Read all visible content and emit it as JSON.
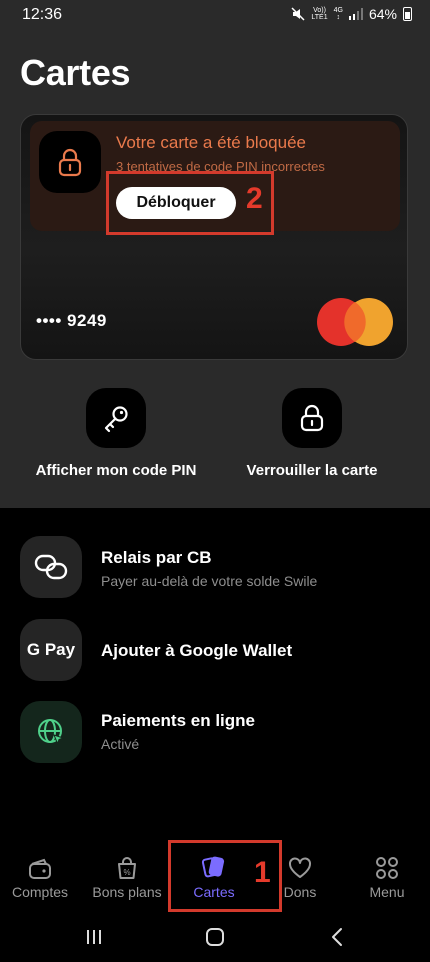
{
  "status_bar": {
    "time": "12:36",
    "volte_top": "Vo))",
    "volte_bottom": "LTE1",
    "network": "4G",
    "battery": "64%"
  },
  "page": {
    "title": "Cartes"
  },
  "card": {
    "banner_title": "Votre carte a été bloquée",
    "banner_subtitle": "3 tentatives de code PIN incorrectes",
    "unlock_label": "Débloquer",
    "masked_number": "•••• 9249",
    "brand_logo": "mastercard-logo"
  },
  "actions": [
    {
      "label": "Afficher mon code PIN",
      "icon": "key-icon"
    },
    {
      "label": "Verrouiller la carte",
      "icon": "lock-icon"
    }
  ],
  "list": [
    {
      "title": "Relais par CB",
      "subtitle": "Payer au-delà de votre solde Swile",
      "icon": "link-icon"
    },
    {
      "title": "Ajouter à Google Wallet",
      "subtitle": "",
      "icon": "google-pay-icon",
      "icon_text": "G Pay"
    },
    {
      "title": "Paiements en ligne",
      "subtitle": "Activé",
      "icon": "globe-cursor-icon"
    }
  ],
  "nav": {
    "items": [
      {
        "label": "Comptes",
        "icon": "wallet-icon"
      },
      {
        "label": "Bons plans",
        "icon": "shopping-bag-icon"
      },
      {
        "label": "Cartes",
        "icon": "cards-icon",
        "active": true
      },
      {
        "label": "Dons",
        "icon": "heart-icon"
      },
      {
        "label": "Menu",
        "icon": "grid-icon"
      }
    ]
  },
  "annotations": {
    "step_1": "1",
    "step_2": "2"
  },
  "colors": {
    "accent": "#7b6cff",
    "warning": "#ea7a4c",
    "annotation": "#e53a2b",
    "background": "#2a2a2a"
  }
}
